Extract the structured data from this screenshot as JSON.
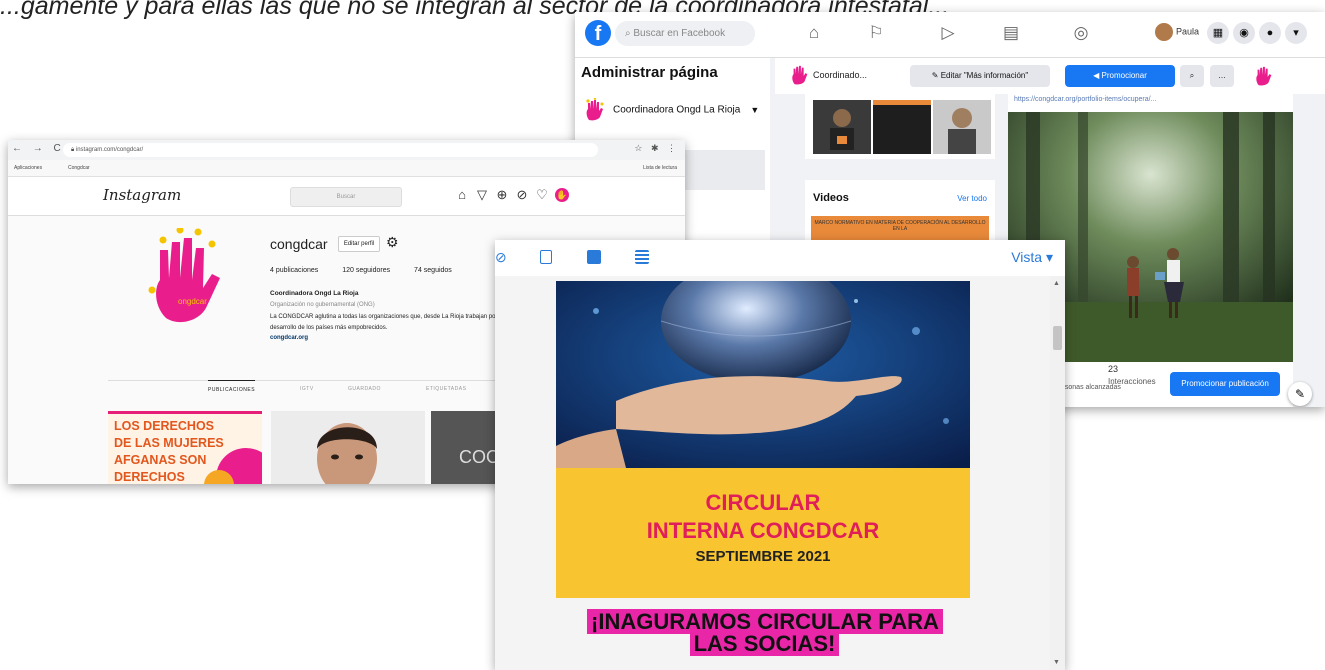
{
  "caption": "...gamente y para ellas las que no se integran al sector de la coordinadora intestatal...",
  "facebook": {
    "logo": "f",
    "search_placeholder": "Buscar en Facebook",
    "user_name": "Paula",
    "side_title": "Administrar página",
    "page_name": "Coordinadora Ongd La Rioja",
    "page_short": "Coordinado...",
    "edit_button": "Editar \"Más información\"",
    "promote_button": "Promocionar",
    "videos_title": "Videos",
    "videos_link": "Ver todo",
    "video_caption": "MARCO NORMATIVO EN MATERIA DE COOPERACIÓN AL DESARROLLO EN LA",
    "post_url": "https://congdcar.org/portfolio-items/ocupera/...",
    "interactions_count": "23",
    "interactions_label": "Interacciones",
    "reach_label": "Personas alcanzadas",
    "promote_post_button": "Promocionar publicación"
  },
  "instagram": {
    "url": "instagram.com/congdcar/",
    "bookmarks_apps": "Aplicaciones",
    "bookmarks_folder": "Congdcar",
    "reading_list": "Lista de lectura",
    "logo": "Instagram",
    "search_placeholder": "Buscar",
    "username": "congdcar",
    "edit_profile": "Editar perfil",
    "stats": {
      "posts": "4 publicaciones",
      "followers": "120 seguidores",
      "following": "74 seguidos"
    },
    "full_name": "Coordinadora Ongd La Rioja",
    "category": "Organización no gubernamental (ONG)",
    "bio": "La CONGDCAR aglutina a todas las organizaciones que, desde La Rioja trabajan por el desarrollo de los países más empobrecidos.",
    "website": "congdcar.org",
    "tabs": [
      "PUBLICACIONES",
      "IGTV",
      "GUARDADO",
      "ETIQUETADAS"
    ],
    "post1_text": "LOS DERECHOS DE LAS MUJERES AFGANAS SON DERECHOS HUMANOS",
    "post3_text": "COO"
  },
  "document": {
    "vista_label": "Vista ▾",
    "circular_line1": "CIRCULAR",
    "circular_line2": "INTERNA CONGDCAR",
    "circular_date": "SEPTIEMBRE 2021",
    "headline": "¡INAGURAMOS CIRCULAR PARA LAS SOCIAS!"
  },
  "colors": {
    "facebook_blue": "#1877f2",
    "brand_pink": "#e91e8c",
    "circular_yellow": "#f8c530",
    "circular_red": "#e01e5a",
    "headline_highlight": "#e925a8"
  },
  "icons": [
    "search-icon",
    "home-icon",
    "flag-icon",
    "video-icon",
    "store-icon",
    "groups-icon",
    "grid-icon",
    "messenger-icon",
    "bell-icon",
    "chevron-down-icon",
    "gear-icon",
    "heart-icon",
    "explore-icon",
    "send-icon",
    "edit-icon"
  ]
}
